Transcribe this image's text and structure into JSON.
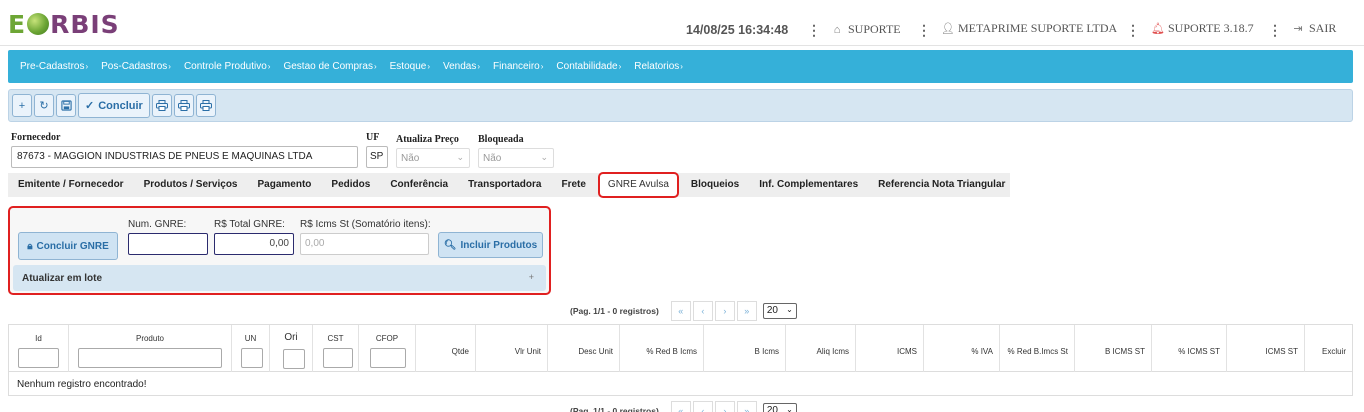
{
  "header": {
    "logo_text": "EORBIS",
    "datetime": "14/08/25 16:34:48",
    "support_label": "SUPORTE",
    "company_label": "METAPRIME SUPORTE LTDA",
    "version_label": "SUPORTE 3.18.7",
    "exit_label": "SAIR"
  },
  "menu": [
    {
      "label": "Pre-Cadastros"
    },
    {
      "label": "Pos-Cadastros"
    },
    {
      "label": "Controle Produtivo"
    },
    {
      "label": "Gestao de Compras"
    },
    {
      "label": "Estoque"
    },
    {
      "label": "Vendas"
    },
    {
      "label": "Financeiro"
    },
    {
      "label": "Contabilidade"
    },
    {
      "label": "Relatorios"
    }
  ],
  "toolbar": {
    "conclude_label": "Concluir"
  },
  "form": {
    "supplier_label": "Fornecedor",
    "supplier_value": "87673 - MAGGION INDUSTRIAS DE PNEUS E MAQUINAS LTDA",
    "uf_label": "UF",
    "uf_value": "SP",
    "update_price_label": "Atualiza Preço",
    "update_price_value": "Não",
    "blocked_label": "Bloqueada",
    "blocked_value": "Não"
  },
  "tabs": [
    {
      "label": "Emitente / Fornecedor"
    },
    {
      "label": "Produtos / Serviços"
    },
    {
      "label": "Pagamento"
    },
    {
      "label": "Pedidos"
    },
    {
      "label": "Conferência"
    },
    {
      "label": "Transportadora"
    },
    {
      "label": "Frete"
    },
    {
      "label": "GNRE Avulsa"
    },
    {
      "label": "Bloqueios"
    },
    {
      "label": "Inf. Complementares"
    },
    {
      "label": "Referencia Nota Triangular"
    }
  ],
  "active_tab": "GNRE Avulsa",
  "gnre": {
    "conclude_button": "Concluir GNRE",
    "num_label": "Num. GNRE:",
    "num_value": "",
    "total_label": "R$ Total GNRE:",
    "total_value": "0,00",
    "icms_label": "R$ Icms St (Somatório itens):",
    "icms_value": "0,00",
    "include_button": "Incluir Produtos",
    "batch_label": "Atualizar em lote",
    "batch_toggle": "+"
  },
  "pagination": {
    "info": "(Pag. 1/1 - 0 registros)",
    "first": "«",
    "prev": "‹",
    "next": "›",
    "last": "»",
    "rows_per_page": "20"
  },
  "grid": {
    "columns": [
      "Id",
      "Produto",
      "UN",
      "Ori",
      "CST",
      "CFOP",
      "Qtde",
      "Vlr Unit",
      "Desc Unit",
      "% Red B Icms",
      "B Icms",
      "Aliq Icms",
      "ICMS",
      "% IVA",
      "% Red B.Imcs St",
      "B ICMS ST",
      "% ICMS ST",
      "ICMS ST",
      "Excluir"
    ],
    "empty_message": "Nenhum registro encontrado!"
  },
  "colors": {
    "menu_bg": "#35b0d9",
    "toolbar_bg": "#d6e6f2",
    "highlight": "#e02020",
    "logo_purple": "#7a3f78",
    "logo_green": "#6da635"
  }
}
